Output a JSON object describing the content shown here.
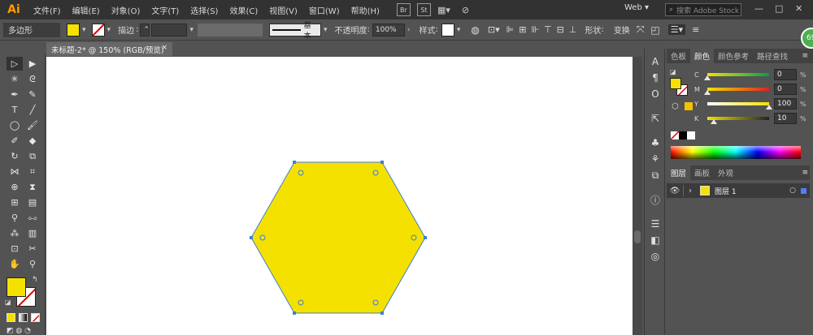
{
  "app": {
    "logo": "Ai"
  },
  "menu": {
    "items": [
      "文件(F)",
      "编辑(E)",
      "对象(O)",
      "文字(T)",
      "选择(S)",
      "效果(C)",
      "视图(V)",
      "窗口(W)",
      "帮助(H)"
    ],
    "br_label": "Br",
    "st_label": "St",
    "workspace": "Web",
    "search_placeholder": "搜索 Adobe Stock"
  },
  "controlbar": {
    "shape_name": "多边形",
    "stroke_label": "描边",
    "brush_label": "基本",
    "opacity_label": "不透明度",
    "opacity_value": "100%",
    "style_label": "样式",
    "shape_label": "形状",
    "transform_label": "变换",
    "fill_color": "#f5e100"
  },
  "document": {
    "tab_title": "未标题-2* @ 150% (RGB/预览)",
    "close_glyph": "×"
  },
  "artwork": {
    "shape": "hexagon",
    "fill_color": "#f5e100",
    "selection_color": "#3f7fd9"
  },
  "color_panel": {
    "tabs": [
      "色板",
      "颜色",
      "颜色参考",
      "路径查找"
    ],
    "active_tab": 1,
    "channels": [
      {
        "label": "C",
        "value": "0",
        "unit": "%",
        "level": 0
      },
      {
        "label": "M",
        "value": "0",
        "unit": "%",
        "level": 0
      },
      {
        "label": "Y",
        "value": "100",
        "unit": "%",
        "level": 1
      },
      {
        "label": "K",
        "value": "10",
        "unit": "%",
        "level": 0.1
      }
    ],
    "fill_color": "#f5e100"
  },
  "layers_panel": {
    "tabs": [
      "图层",
      "画板",
      "外观"
    ],
    "active_tab": 0,
    "layer_name": "图层 1",
    "layer_color": "#4f7fff"
  },
  "badge": {
    "text": "69"
  }
}
